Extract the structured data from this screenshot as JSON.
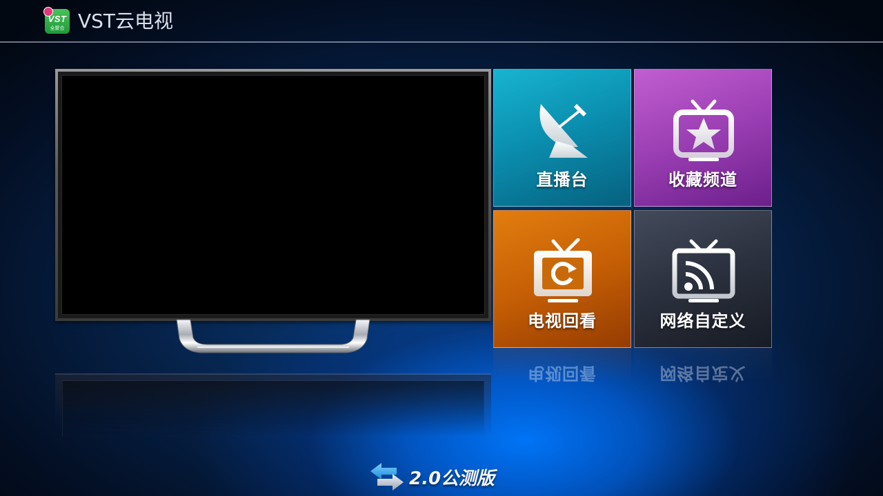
{
  "header": {
    "app_title": "VST云电视",
    "logo_text": "VST",
    "logo_sub": "全聚合"
  },
  "preview": {
    "screen_state": "blank"
  },
  "tiles": [
    {
      "id": "live",
      "label": "直播台",
      "icon": "satellite-dish-icon",
      "color": "#0b8fb0"
    },
    {
      "id": "favorites",
      "label": "收藏频道",
      "icon": "tv-star-icon",
      "color": "#9a3eb3"
    },
    {
      "id": "playback",
      "label": "电视回看",
      "icon": "tv-replay-icon",
      "color": "#c65f05"
    },
    {
      "id": "network",
      "label": "网络自定义",
      "icon": "tv-broadcast-icon",
      "color": "#2a303d"
    }
  ],
  "footer": {
    "beta_label": "2.0公测版",
    "icon": "swap-arrows-icon"
  }
}
